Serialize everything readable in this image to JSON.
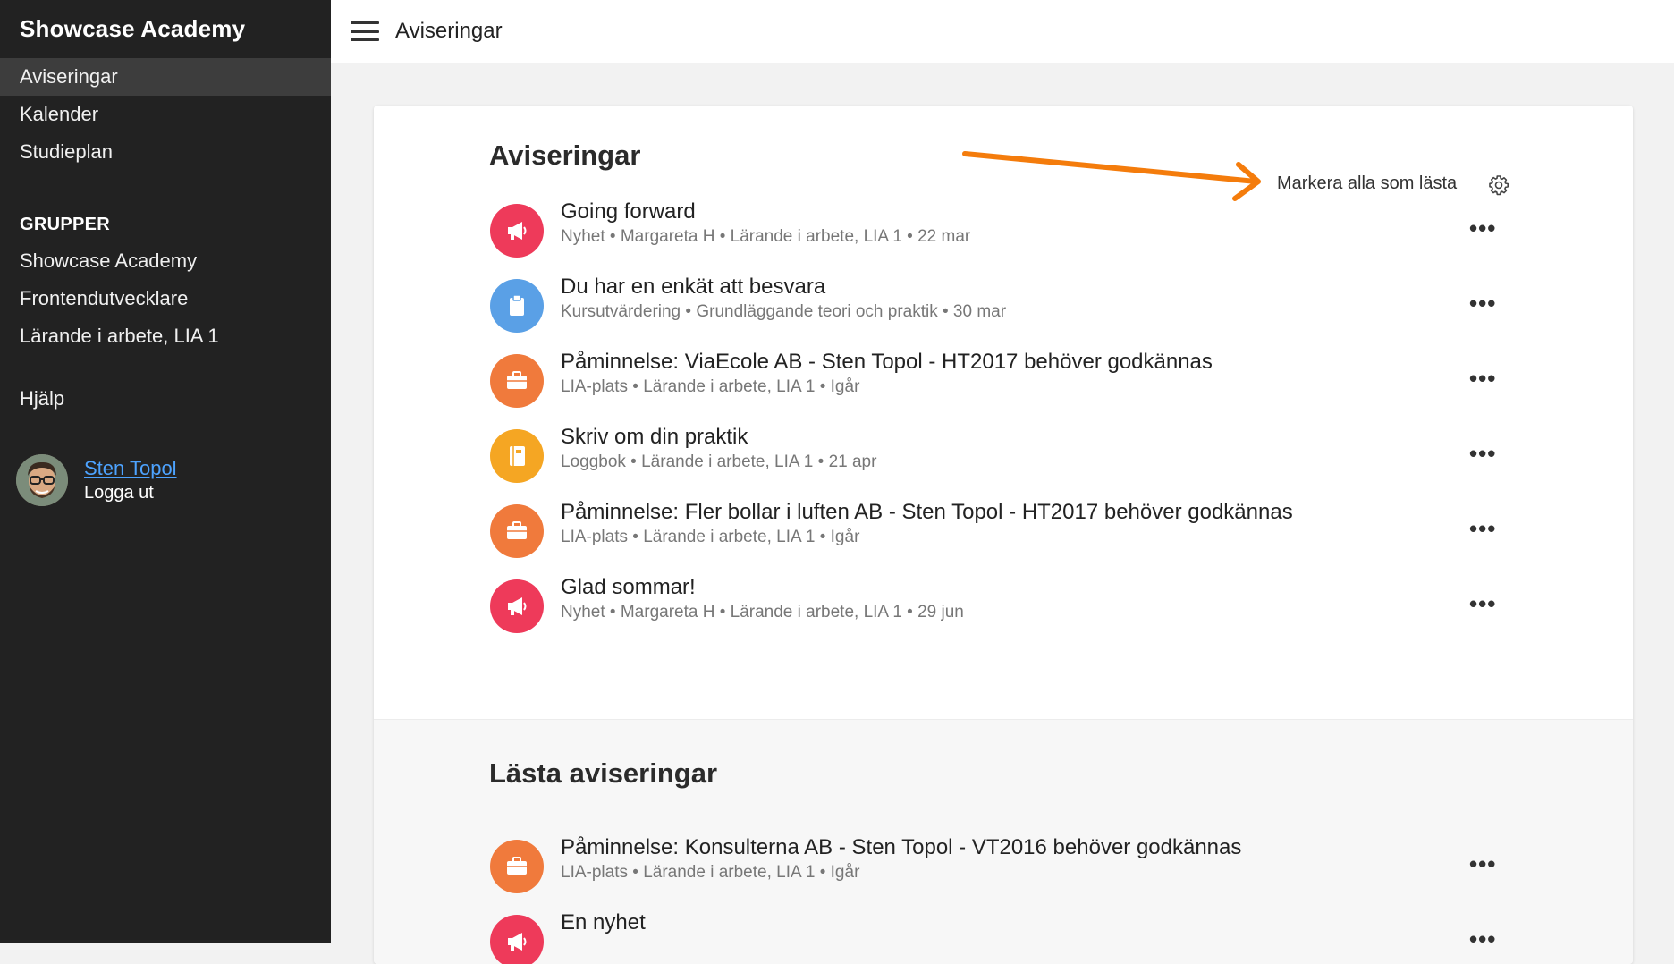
{
  "app": {
    "brand": "Showcase Academy"
  },
  "sidebar": {
    "nav": [
      {
        "label": "Aviseringar",
        "active": true
      },
      {
        "label": "Kalender"
      },
      {
        "label": "Studieplan"
      }
    ],
    "groups_heading": "GRUPPER",
    "groups": [
      {
        "label": "Showcase Academy"
      },
      {
        "label": "Frontendutvecklare"
      },
      {
        "label": "Lärande i arbete, LIA 1"
      }
    ],
    "help": "Hjälp",
    "user": {
      "name": "Sten Topol",
      "logout": "Logga ut"
    }
  },
  "topbar": {
    "title": "Aviseringar",
    "menu_icon": "hamburger-icon"
  },
  "main": {
    "unread": {
      "title": "Aviseringar",
      "mark_all": "Markera alla som lästa",
      "settings_icon": "gear-icon",
      "items": [
        {
          "title": "Going forward",
          "meta": "Nyhet • Margareta H • Lärande i arbete, LIA 1 • 22 mar",
          "icon": "megaphone-icon",
          "color": "#ee3a5a",
          "more": "•••"
        },
        {
          "title": "Du har en enkät att besvara",
          "meta": "Kursutvärdering • Grundläggande teori och praktik • 30 mar",
          "icon": "clipboard-icon",
          "color": "#5aa0e6",
          "more": "•••"
        },
        {
          "title": "Påminnelse: ViaEcole AB - Sten Topol - HT2017 behöver godkännas",
          "meta": "LIA-plats • Lärande i arbete, LIA 1 • Igår",
          "icon": "briefcase-icon",
          "color": "#f07a3c",
          "more": "•••"
        },
        {
          "title": "Skriv om din praktik",
          "meta": "Loggbok • Lärande i arbete, LIA 1 • 21 apr",
          "icon": "notebook-icon",
          "color": "#f5a623",
          "more": "•••"
        },
        {
          "title": "Påminnelse: Fler bollar i luften AB - Sten Topol - HT2017 behöver godkännas",
          "meta": "LIA-plats • Lärande i arbete, LIA 1 • Igår",
          "icon": "briefcase-icon",
          "color": "#f07a3c",
          "more": "•••"
        },
        {
          "title": "Glad sommar!",
          "meta": "Nyhet • Margareta H • Lärande i arbete, LIA 1 • 29 jun",
          "icon": "megaphone-icon",
          "color": "#ee3a5a",
          "more": "•••"
        }
      ]
    },
    "read": {
      "title": "Lästa aviseringar",
      "items": [
        {
          "title": "Påminnelse: Konsulterna AB - Sten Topol - VT2016 behöver godkännas",
          "meta": "LIA-plats • Lärande i arbete, LIA 1 • Igår",
          "icon": "briefcase-icon",
          "color": "#f07a3c",
          "more": "•••"
        },
        {
          "title": "En nyhet",
          "meta": "",
          "icon": "megaphone-icon",
          "color": "#ee3a5a",
          "more": "•••"
        }
      ]
    }
  },
  "colors": {
    "sidebar_bg": "#222222",
    "active_bg": "#3d3d3d",
    "link": "#4da3ff",
    "annotation_arrow": "#f47c0c"
  }
}
